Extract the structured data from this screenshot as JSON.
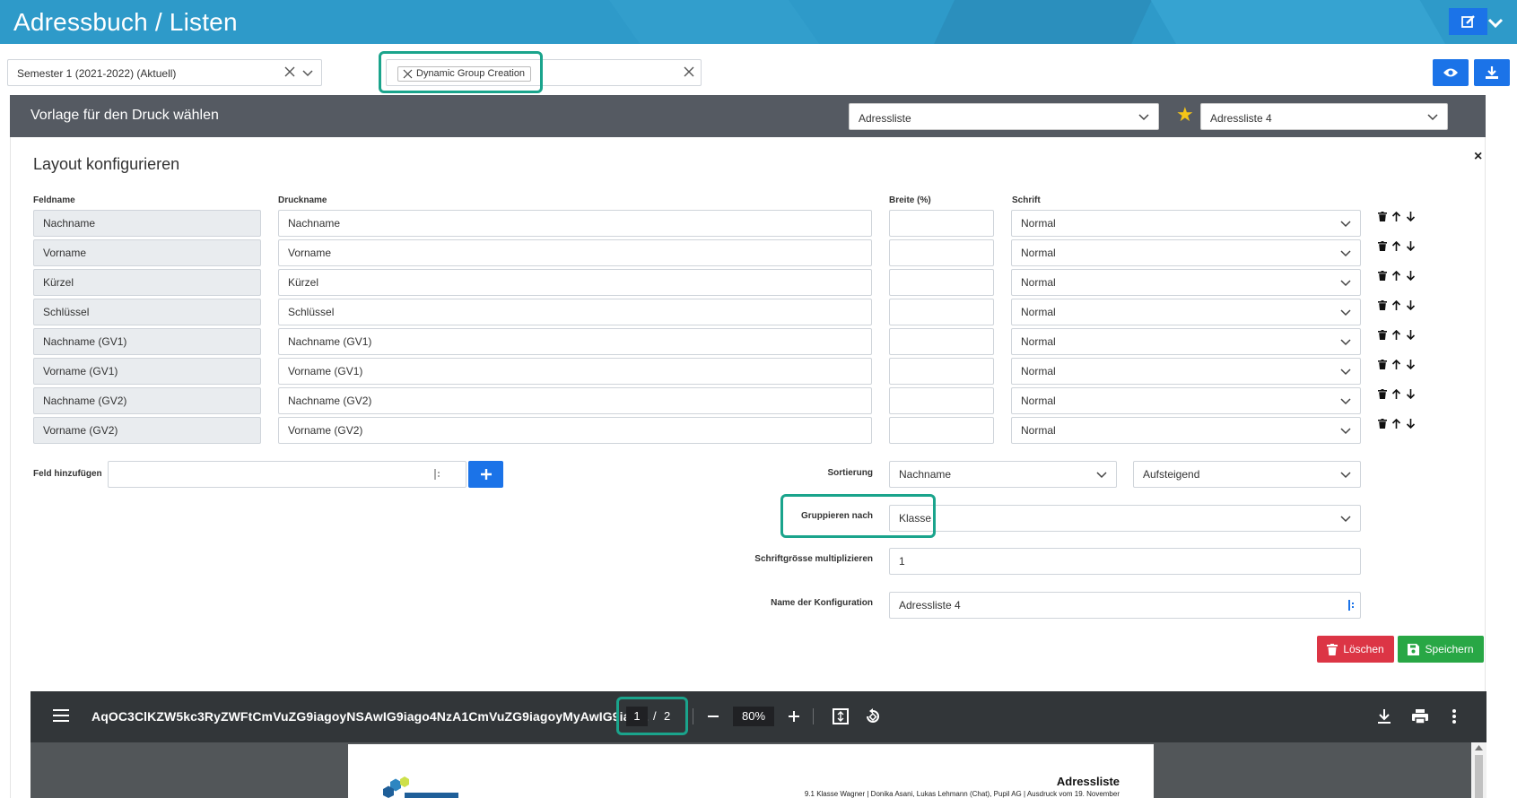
{
  "header": {
    "title": "Adressbuch / Listen"
  },
  "filters": {
    "semester": "Semester 1 (2021-2022) (Aktuell)",
    "group_chip": "Dynamic Group Creation"
  },
  "template_bar": {
    "title": "Vorlage für den Druck wählen",
    "template_type": "Adressliste",
    "template_name": "Adressliste 4"
  },
  "layout": {
    "title": "Layout konfigurieren",
    "close": "×",
    "headers": {
      "feldname": "Feldname",
      "druckname": "Druckname",
      "breite": "Breite (%)",
      "schrift": "Schrift"
    },
    "rows": [
      {
        "feldname": "Nachname",
        "druckname": "Nachname",
        "breite": "",
        "schrift": "Normal"
      },
      {
        "feldname": "Vorname",
        "druckname": "Vorname",
        "breite": "",
        "schrift": "Normal"
      },
      {
        "feldname": "Kürzel",
        "druckname": "Kürzel",
        "breite": "",
        "schrift": "Normal"
      },
      {
        "feldname": "Schlüssel",
        "druckname": "Schlüssel",
        "breite": "",
        "schrift": "Normal"
      },
      {
        "feldname": "Nachname (GV1)",
        "druckname": "Nachname (GV1)",
        "breite": "",
        "schrift": "Normal"
      },
      {
        "feldname": "Vorname (GV1)",
        "druckname": "Vorname (GV1)",
        "breite": "",
        "schrift": "Normal"
      },
      {
        "feldname": "Nachname (GV2)",
        "druckname": "Nachname (GV2)",
        "breite": "",
        "schrift": "Normal"
      },
      {
        "feldname": "Vorname (GV2)",
        "druckname": "Vorname (GV2)",
        "breite": "",
        "schrift": "Normal"
      }
    ],
    "add_field_label": "Feld hinzufügen",
    "sort_label": "Sortierung",
    "sort_field": "Nachname",
    "sort_order": "Aufsteigend",
    "group_label": "Gruppieren nach",
    "group_value": "Klasse",
    "font_mult_label": "Schriftgrösse multiplizieren",
    "font_mult_value": "1",
    "config_name_label": "Name der Konfiguration",
    "config_name_value": "Adressliste 4",
    "delete_label": "Löschen",
    "save_label": "Speichern"
  },
  "pdf": {
    "title": "AqOC3ClKZW5kc3RyZWFtCmVuZG9iagoyNSAwIG9iago4NzA1CmVuZG9iagoyMyAwIG9iag...",
    "page_current": "1",
    "page_sep": "/",
    "page_total": "2",
    "zoom": "80%",
    "doc_heading": "Adressliste",
    "doc_subline": "9.1 Klasse Wagner | Donika Asani, Lukas Lehmann (Chat), Pupil AG | Ausdruck vom 19. November"
  },
  "colors": {
    "header": "#2e9ac9",
    "primary": "#1b73e8",
    "danger": "#dc3545",
    "success": "#28a745",
    "highlight": "#1aa48c"
  }
}
